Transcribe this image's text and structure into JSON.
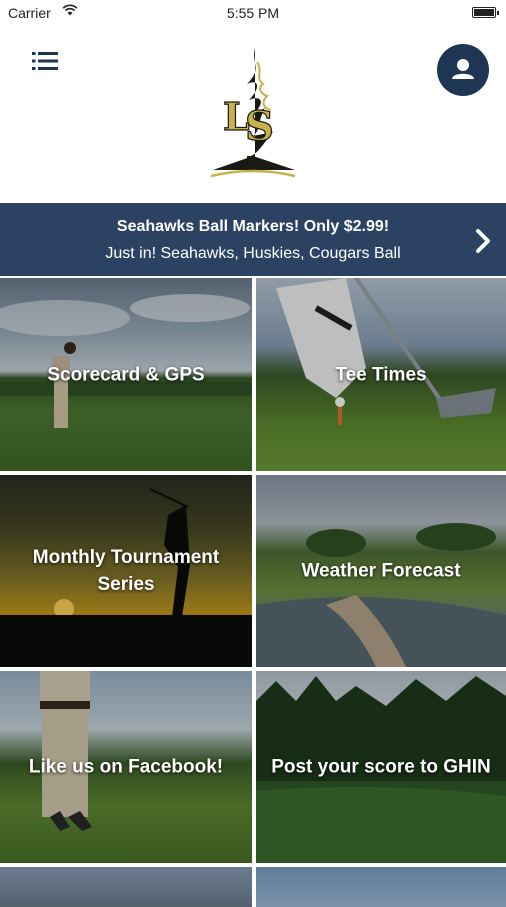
{
  "status_bar": {
    "carrier": "Carrier",
    "time": "5:55 PM",
    "battery_level": 1.0
  },
  "header": {
    "menu_icon": "hamburger-menu-icon",
    "logo_icon": "ls-flame-logo",
    "profile_icon": "user-icon",
    "accent_color": "#1e3553"
  },
  "promo": {
    "title": "Seahawks Ball Markers! Only $2.99!",
    "subtitle": "Just in! Seahawks, Huskies, Cougars Ball",
    "chevron_icon": "chevron-right-icon",
    "background_color": "#2b4262"
  },
  "tiles": [
    {
      "label": "Scorecard & GPS"
    },
    {
      "label": "Tee Times"
    },
    {
      "label": "Monthly Tournament Series"
    },
    {
      "label": "Weather Forecast"
    },
    {
      "label": "Like us on Facebook!"
    },
    {
      "label": "Post your score to GHIN"
    }
  ]
}
